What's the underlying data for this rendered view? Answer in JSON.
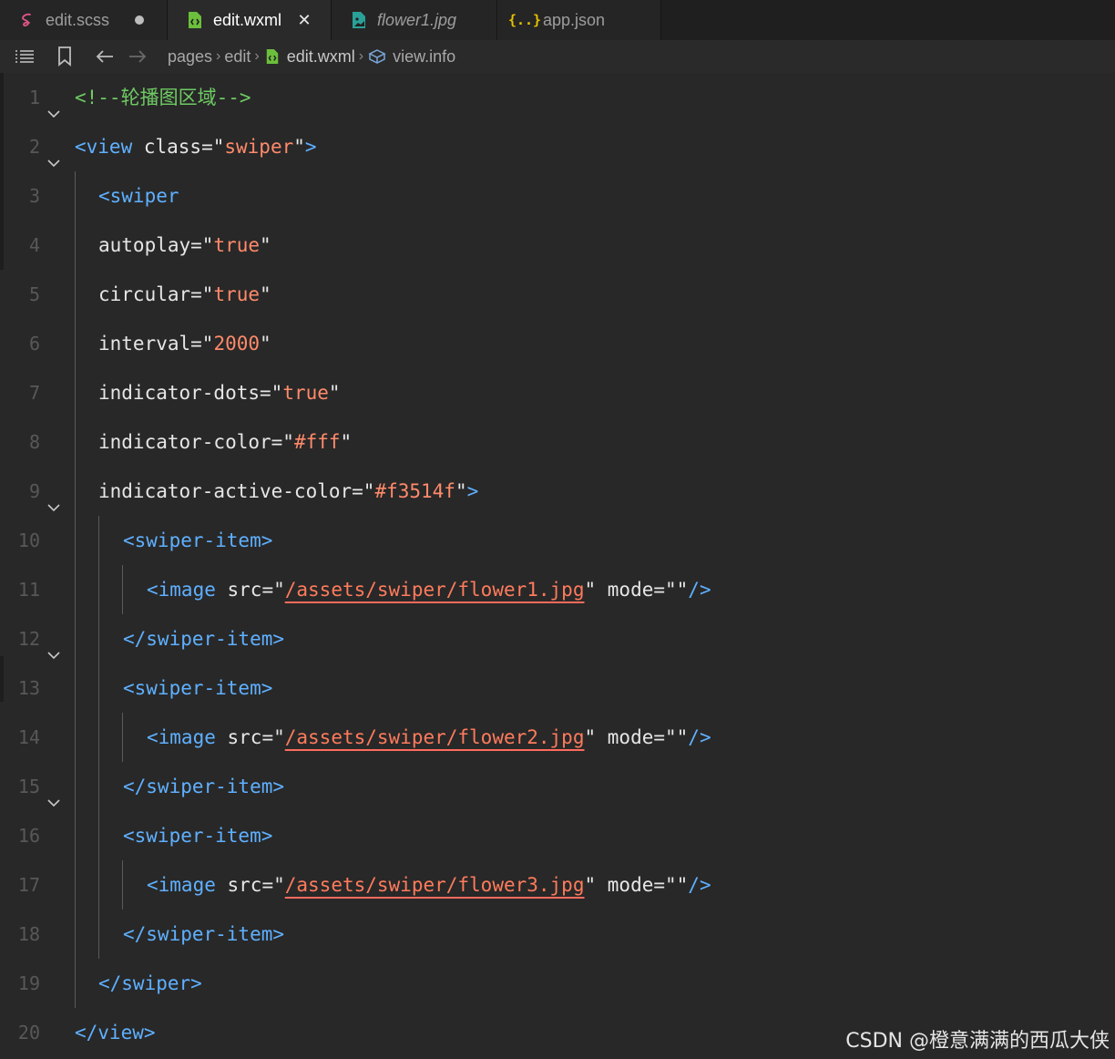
{
  "tabs": [
    {
      "label": "edit.scss",
      "icon": "sass-icon",
      "modified": true
    },
    {
      "label": "edit.wxml",
      "icon": "wxml-file-icon",
      "active": true
    },
    {
      "label": "flower1.jpg",
      "icon": "image-file-icon",
      "italic": true
    },
    {
      "label": "app.json",
      "icon": "json-braces-icon"
    }
  ],
  "breadcrumb": {
    "items": [
      "pages",
      "edit",
      "edit.wxml",
      "view.info"
    ]
  },
  "code_lines": [
    {
      "num": "1",
      "tokens": [
        {
          "t": "<!--轮播图区域-->",
          "c": "comment"
        }
      ]
    },
    {
      "num": "2",
      "tokens": [
        {
          "t": "<view ",
          "c": "tag"
        },
        {
          "t": "class=",
          "c": "attr"
        },
        {
          "t": "\"",
          "c": "attr"
        },
        {
          "t": "swiper",
          "c": "str"
        },
        {
          "t": "\"",
          "c": "attr"
        },
        {
          "t": ">",
          "c": "tag"
        }
      ]
    },
    {
      "num": "3",
      "tokens": [
        {
          "t": "<swiper",
          "c": "tag"
        }
      ]
    },
    {
      "num": "4",
      "tokens": [
        {
          "t": "autoplay=",
          "c": "attr"
        },
        {
          "t": "\"",
          "c": "attr"
        },
        {
          "t": "true",
          "c": "str"
        },
        {
          "t": "\"",
          "c": "attr"
        }
      ]
    },
    {
      "num": "5",
      "tokens": [
        {
          "t": "circular=",
          "c": "attr"
        },
        {
          "t": "\"",
          "c": "attr"
        },
        {
          "t": "true",
          "c": "str"
        },
        {
          "t": "\"",
          "c": "attr"
        }
      ]
    },
    {
      "num": "6",
      "tokens": [
        {
          "t": "interval=",
          "c": "attr"
        },
        {
          "t": "\"",
          "c": "attr"
        },
        {
          "t": "2000",
          "c": "str"
        },
        {
          "t": "\"",
          "c": "attr"
        }
      ]
    },
    {
      "num": "7",
      "tokens": [
        {
          "t": "indicator-dots=",
          "c": "attr"
        },
        {
          "t": "\"",
          "c": "attr"
        },
        {
          "t": "true",
          "c": "str"
        },
        {
          "t": "\"",
          "c": "attr"
        }
      ]
    },
    {
      "num": "8",
      "tokens": [
        {
          "t": "indicator-color=",
          "c": "attr"
        },
        {
          "t": "\"",
          "c": "attr"
        },
        {
          "t": "#fff",
          "c": "str"
        },
        {
          "t": "\"",
          "c": "attr"
        }
      ]
    },
    {
      "num": "9",
      "tokens": [
        {
          "t": "indicator-active-color=",
          "c": "attr"
        },
        {
          "t": "\"",
          "c": "attr"
        },
        {
          "t": "#f3514f",
          "c": "str"
        },
        {
          "t": "\"",
          "c": "attr"
        },
        {
          "t": ">",
          "c": "tag"
        }
      ]
    },
    {
      "num": "10",
      "tokens": [
        {
          "t": "<swiper-item>",
          "c": "tag"
        }
      ]
    },
    {
      "num": "11",
      "tokens": [
        {
          "t": "<image ",
          "c": "tag"
        },
        {
          "t": "src=",
          "c": "attr"
        },
        {
          "t": "\"",
          "c": "attr"
        },
        {
          "t": "/assets/swiper/flower1.jpg",
          "c": "path"
        },
        {
          "t": "\"",
          "c": "attr"
        },
        {
          "t": " mode=",
          "c": "attr"
        },
        {
          "t": "\"\"",
          "c": "attr"
        },
        {
          "t": "/>",
          "c": "tag"
        }
      ]
    },
    {
      "num": "12",
      "tokens": [
        {
          "t": "</swiper-item>",
          "c": "tag"
        }
      ]
    },
    {
      "num": "13",
      "tokens": [
        {
          "t": "<swiper-item>",
          "c": "tag"
        }
      ]
    },
    {
      "num": "14",
      "tokens": [
        {
          "t": "<image ",
          "c": "tag"
        },
        {
          "t": "src=",
          "c": "attr"
        },
        {
          "t": "\"",
          "c": "attr"
        },
        {
          "t": "/assets/swiper/flower2.jpg",
          "c": "path"
        },
        {
          "t": "\"",
          "c": "attr"
        },
        {
          "t": " mode=",
          "c": "attr"
        },
        {
          "t": "\"\"",
          "c": "attr"
        },
        {
          "t": "/>",
          "c": "tag"
        }
      ]
    },
    {
      "num": "15",
      "tokens": [
        {
          "t": "</swiper-item>",
          "c": "tag"
        }
      ]
    },
    {
      "num": "16",
      "tokens": [
        {
          "t": "<swiper-item>",
          "c": "tag"
        }
      ]
    },
    {
      "num": "17",
      "tokens": [
        {
          "t": "<image ",
          "c": "tag"
        },
        {
          "t": "src=",
          "c": "attr"
        },
        {
          "t": "\"",
          "c": "attr"
        },
        {
          "t": "/assets/swiper/flower3.jpg",
          "c": "path"
        },
        {
          "t": "\"",
          "c": "attr"
        },
        {
          "t": " mode=",
          "c": "attr"
        },
        {
          "t": "\"\"",
          "c": "attr"
        },
        {
          "t": "/>",
          "c": "tag"
        }
      ]
    },
    {
      "num": "18",
      "tokens": [
        {
          "t": "</swiper-item>",
          "c": "tag"
        }
      ]
    },
    {
      "num": "19",
      "tokens": [
        {
          "t": "</swiper>",
          "c": "tag"
        }
      ]
    },
    {
      "num": "20",
      "tokens": [
        {
          "t": "</view>",
          "c": "tag"
        }
      ]
    }
  ],
  "watermark": "CSDN @橙意满满的西瓜大侠",
  "colors": {
    "background": "#282828",
    "tag": "#5fb0ff",
    "string": "#ff8a6b",
    "comment": "#6ecb63"
  }
}
